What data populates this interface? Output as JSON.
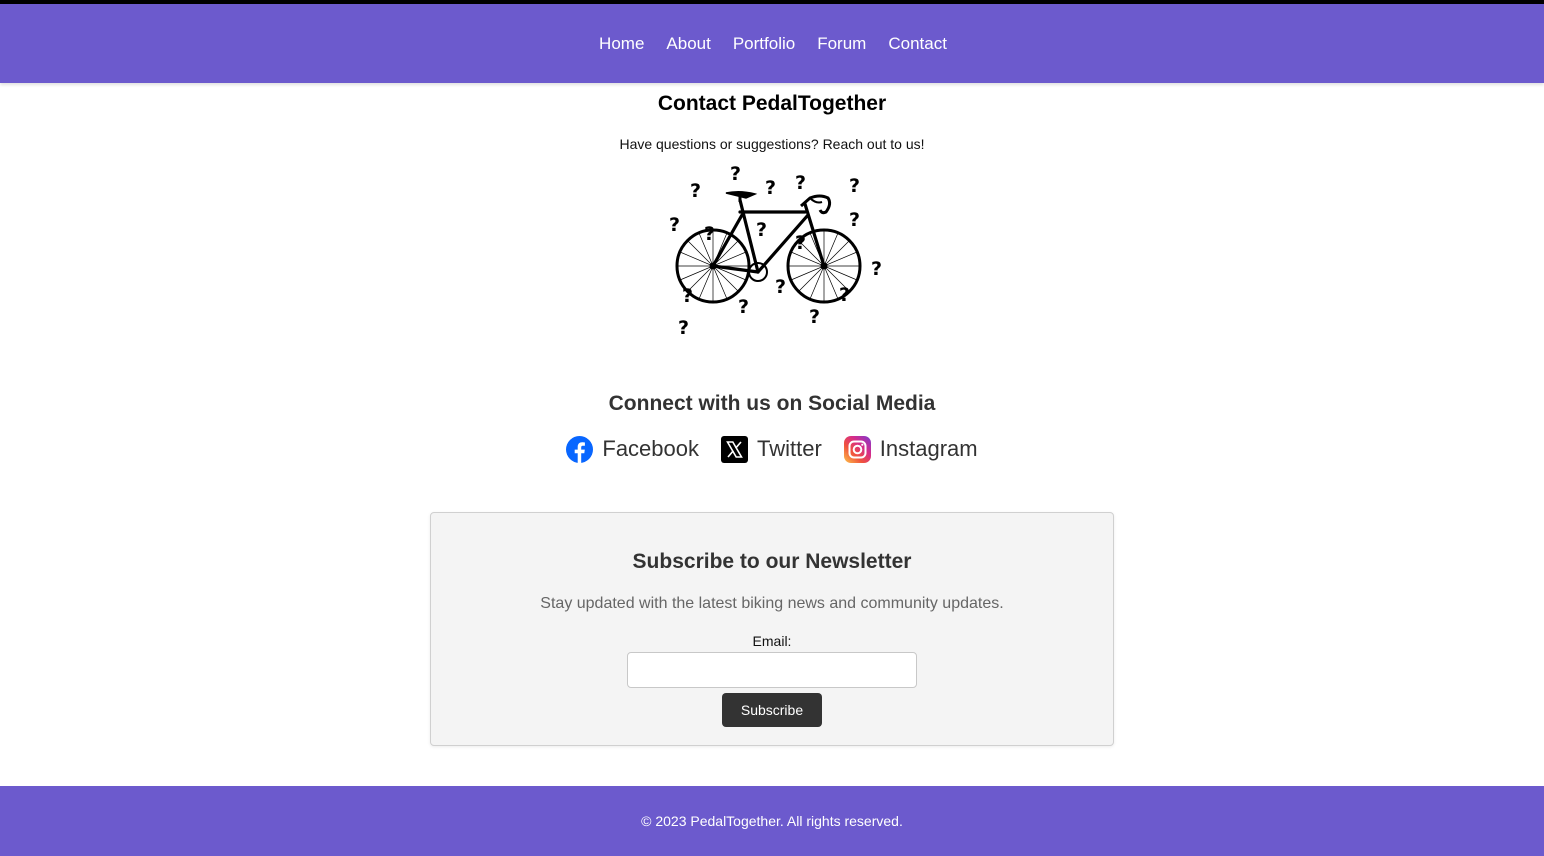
{
  "nav": {
    "items": [
      {
        "label": "Home"
      },
      {
        "label": "About"
      },
      {
        "label": "Portfolio"
      },
      {
        "label": "Forum"
      },
      {
        "label": "Contact"
      }
    ]
  },
  "contact": {
    "title": "Contact PedalTogether",
    "subtitle": "Have questions or suggestions? Reach out to us!",
    "illustration": "bicycle-with-question-marks"
  },
  "social": {
    "title": "Connect with us on Social Media",
    "links": [
      {
        "label": "Facebook",
        "icon": "facebook-icon"
      },
      {
        "label": "Twitter",
        "icon": "x-twitter-icon"
      },
      {
        "label": "Instagram",
        "icon": "instagram-icon"
      }
    ]
  },
  "newsletter": {
    "title": "Subscribe to our Newsletter",
    "description": "Stay updated with the latest biking news and community updates.",
    "email_label": "Email:",
    "email_value": "",
    "button_label": "Subscribe"
  },
  "footer": {
    "text": "© 2023 PedalTogether. All rights reserved."
  },
  "colors": {
    "brand": "#6c5acd",
    "button": "#333333",
    "panel": "#f4f4f4"
  }
}
